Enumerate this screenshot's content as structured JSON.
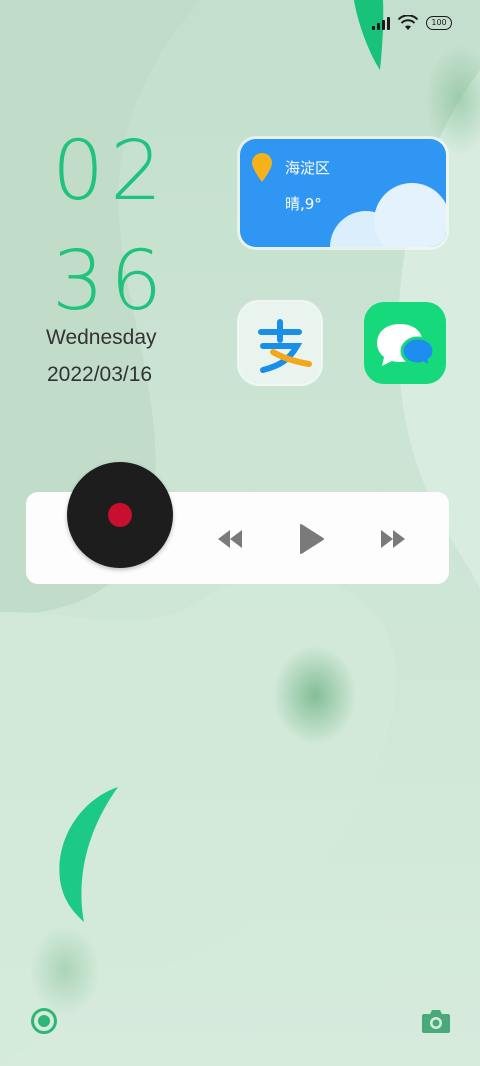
{
  "status": {
    "battery": "100",
    "icons": [
      "signal-icon",
      "wifi-icon",
      "battery-icon"
    ]
  },
  "clock": {
    "hour": "02",
    "minute": "36",
    "weekday": "Wednesday",
    "date": "2022/03/16",
    "color": "#1fc27f"
  },
  "weather": {
    "location": "海淀区",
    "condition": "晴,9°",
    "color": "#2f96f3"
  },
  "apps": [
    {
      "name": "Alipay",
      "icon": "alipay-icon"
    },
    {
      "name": "Messages",
      "icon": "messages-icon"
    }
  ],
  "music": {
    "controls": [
      "previous-icon",
      "play-icon",
      "next-icon"
    ]
  },
  "bottom": {
    "left_icon": "ring-icon",
    "right_icon": "camera-icon"
  }
}
